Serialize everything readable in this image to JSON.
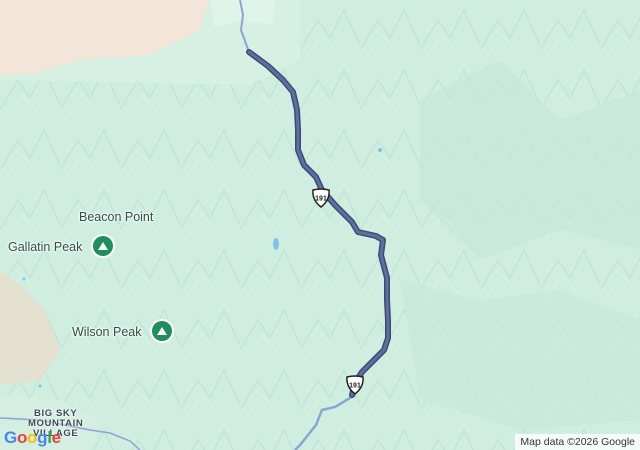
{
  "map": {
    "labels": {
      "beacon_point": "Beacon Point",
      "gallatin_peak": "Gallatin Peak",
      "wilson_peak": "Wilson Peak",
      "big_sky_line1": "BIG SKY",
      "big_sky_line2": "MOUNTAIN",
      "big_sky_line3": "VILLAGE"
    },
    "route": {
      "shield_text": "191",
      "color": "#4a5a86"
    },
    "attribution": "Map data ©2026 Google",
    "google_logo": [
      "G",
      "o",
      "o",
      "g",
      "l",
      "e"
    ],
    "colors": {
      "terrain": "#cfeee0",
      "peak_marker": "#1e8e5a",
      "desert": "#f1e6d8",
      "water": "#7fc4e8"
    }
  }
}
